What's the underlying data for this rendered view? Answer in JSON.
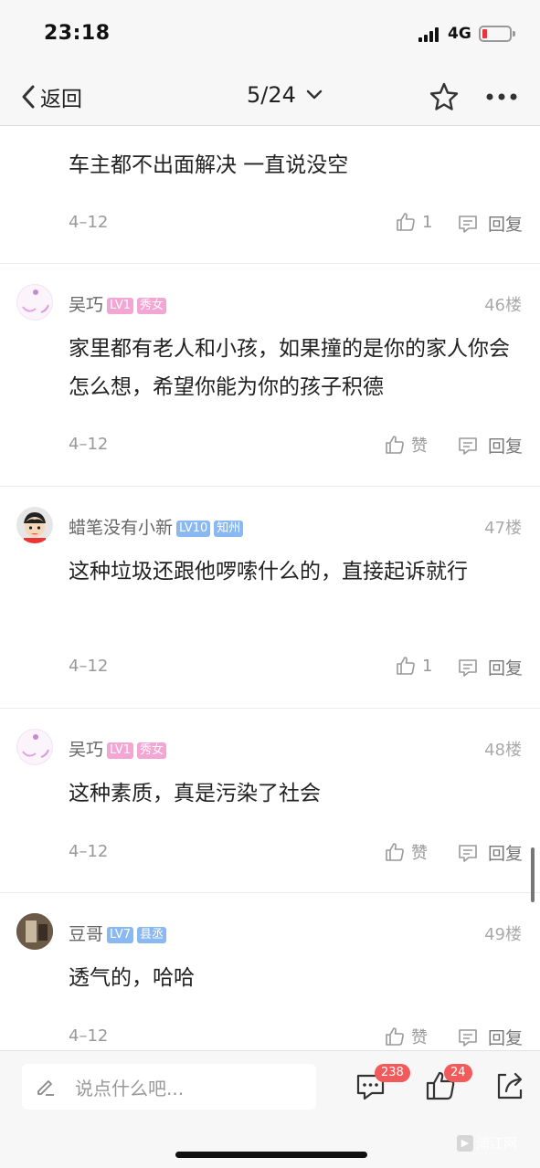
{
  "status_bar": {
    "time": "23:18",
    "network": "4G"
  },
  "nav": {
    "back_label": "返回",
    "page_indicator": "5/24"
  },
  "comments": [
    {
      "username": "",
      "floor": "",
      "content": "车主都不出面解决   一直说没空",
      "date": "4–12",
      "like_label": "1",
      "reply_label": "回复"
    },
    {
      "username": "吴巧",
      "level": "LV1",
      "tag": "秀女",
      "floor": "46楼",
      "content": "家里都有老人和小孩，如果撞的是你的家人你会怎么想，希望你能为你的孩子积德",
      "date": "4–12",
      "like_label": "赞",
      "reply_label": "回复"
    },
    {
      "username": "蜡笔没有小新",
      "level": "LV10",
      "tag": "知州",
      "floor": "47楼",
      "content": "这种垃圾还跟他啰嗦什么的，直接起诉就行",
      "date": "4–12",
      "like_label": "1",
      "reply_label": "回复"
    },
    {
      "username": "吴巧",
      "level": "LV1",
      "tag": "秀女",
      "floor": "48楼",
      "content": "这种素质，真是污染了社会",
      "date": "4–12",
      "like_label": "赞",
      "reply_label": "回复"
    },
    {
      "username": "豆哥",
      "level": "LV7",
      "tag": "县丞",
      "floor": "49楼",
      "content": "透气的，哈哈",
      "date": "4–12",
      "like_label": "赞",
      "reply_label": "回复"
    }
  ],
  "bottom_bar": {
    "input_placeholder": "说点什么吧...",
    "comment_count": "238",
    "like_count": "24",
    "watermark": "浦江网"
  },
  "colors": {
    "badge_pink": "#f3a6d3",
    "badge_blue": "#8ab8f0",
    "badge_red": "#f25b5b",
    "battery_red": "#e8343e"
  }
}
